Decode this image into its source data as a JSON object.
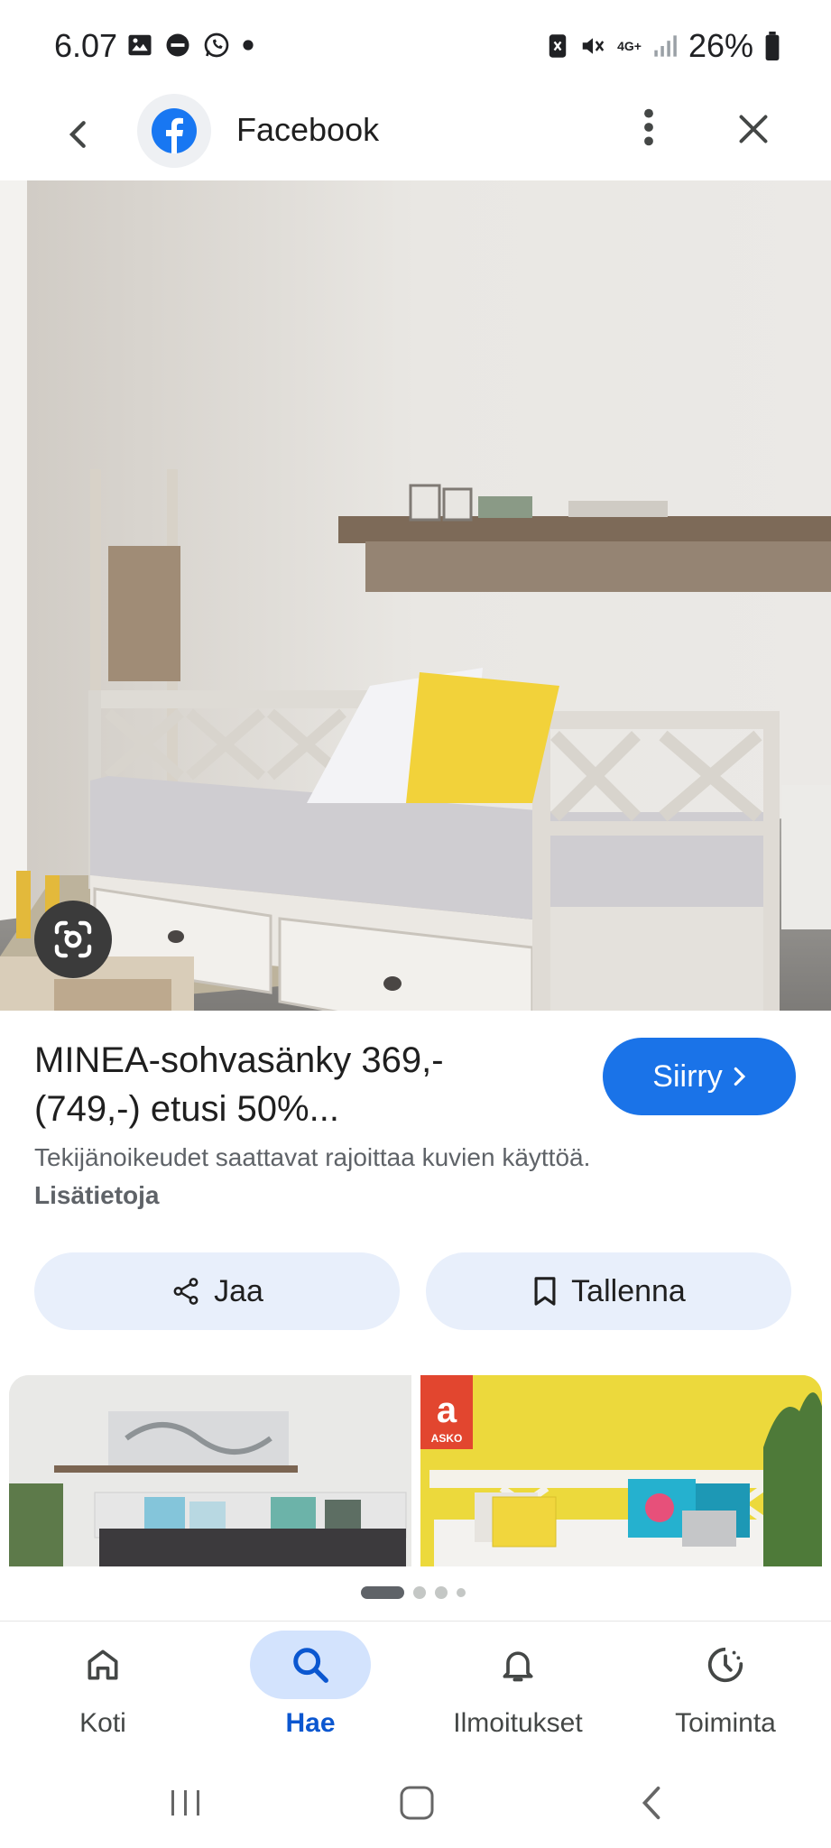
{
  "status_bar": {
    "time": "6.07",
    "battery": "26%",
    "network": "4G+"
  },
  "header": {
    "title": "Facebook"
  },
  "result": {
    "title": "MINEA-sohvasänky 369,- (749,-) etusi 50%...",
    "visit_label": "Siirry",
    "copyright_text": "Tekijänoikeudet saattavat rajoittaa kuvien käyttöä.",
    "more_info_link": "Lisätietoja"
  },
  "actions": {
    "share_label": "Jaa",
    "save_label": "Tallenna"
  },
  "thumbnails": [
    {
      "name": "related-image-1"
    },
    {
      "name": "related-image-2",
      "badge": "ASKO"
    }
  ],
  "pager": {
    "count": 4,
    "active": 0
  },
  "bottom_nav": {
    "items": [
      {
        "label": "Koti",
        "icon": "home-icon",
        "active": false
      },
      {
        "label": "Hae",
        "icon": "search-icon",
        "active": true
      },
      {
        "label": "Ilmoitukset",
        "icon": "bell-icon",
        "active": false
      },
      {
        "label": "Toiminta",
        "icon": "activity-icon",
        "active": false
      }
    ]
  },
  "colors": {
    "accent": "#1a73e8",
    "facebook": "#1877f2",
    "chip_bg": "#e8effb",
    "nav_active_bg": "#d3e3fd",
    "nav_active_text": "#0b57d0"
  }
}
